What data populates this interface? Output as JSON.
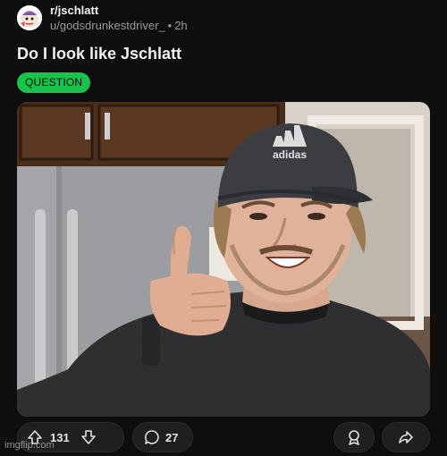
{
  "post": {
    "subreddit": "r/jschlatt",
    "author": "u/godsdrunkestdriver_",
    "separator": "•",
    "time_ago": "2h",
    "title": "Do I look like Jschlatt",
    "flair": "QUESTION",
    "image_text": {
      "cap_brand": "adidas"
    }
  },
  "actions": {
    "upvote_count": "131",
    "comment_count": "27"
  },
  "watermark": "imgflip.com",
  "colors": {
    "background": "#0e0e0e",
    "flair": "#19c34b",
    "pill": "#1f1f1f"
  },
  "icons": {
    "upvote": "upvote-arrow-icon",
    "downvote": "downvote-arrow-icon",
    "comment": "comment-bubble-icon",
    "award": "award-icon",
    "share": "share-arrow-icon"
  }
}
